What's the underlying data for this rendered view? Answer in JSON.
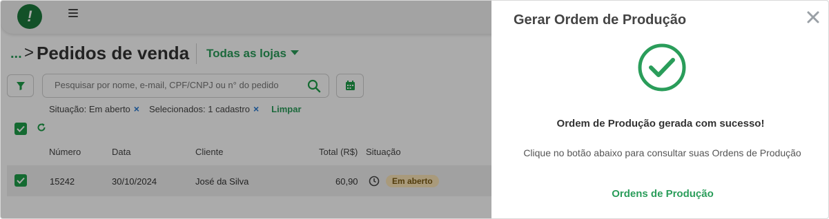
{
  "app": {
    "logo_text": "!",
    "breadcrumb_ellipsis": "...",
    "breadcrumb_separator": ">",
    "page_title": "Pedidos de venda",
    "store_selector": "Todas as lojas",
    "search": {
      "placeholder": "Pesquisar por nome, e-mail, CPF/CNPJ ou n° do pedido"
    },
    "filters": {
      "chips": [
        {
          "label": "Situação: Em aberto",
          "remove": "×"
        },
        {
          "label": "Selecionados: 1 cadastro",
          "remove": "×"
        }
      ],
      "clear_label": "Limpar"
    },
    "table": {
      "headers": [
        "Número",
        "Data",
        "Cliente",
        "Total (R$)",
        "Situação"
      ],
      "rows": [
        {
          "numero": "15242",
          "data": "30/10/2024",
          "cliente": "José da Silva",
          "total": "60,90",
          "situacao": "Em aberto",
          "checked": true
        }
      ]
    },
    "icons": [
      "menu-icon",
      "filter-icon",
      "search-icon",
      "calendar-icon",
      "refresh-icon",
      "clock-icon",
      "checkbox-icon"
    ],
    "colors": {
      "brand_green": "#2a9d5a",
      "checkbox_green": "#1e9e4a",
      "status_badge_bg": "#fde6b8"
    }
  },
  "modal": {
    "title": "Gerar Ordem de Produção",
    "close_icon": "close-icon",
    "success_icon": "check-circle-icon",
    "success_message": "Ordem de Produção gerada com sucesso!",
    "info_text": "Clique no botão abaixo para consultar suas Ordens de Produção",
    "link_label": "Ordens de Produção"
  }
}
